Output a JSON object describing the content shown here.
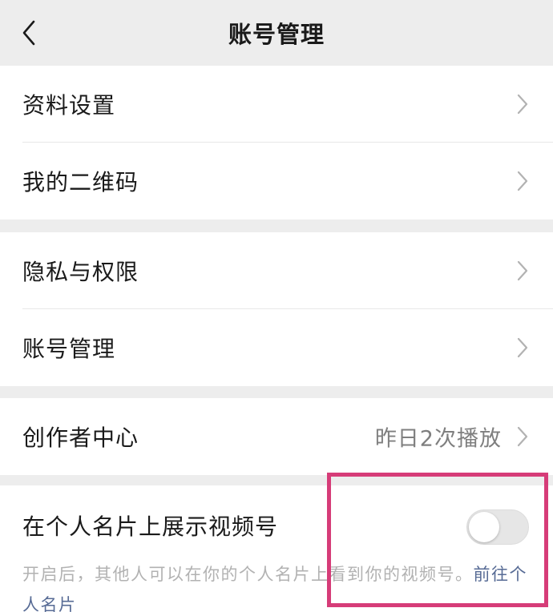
{
  "header": {
    "title": "账号管理",
    "back_icon": "chevron-left-icon"
  },
  "group1": {
    "items": [
      {
        "label": "资料设置"
      },
      {
        "label": "我的二维码"
      }
    ]
  },
  "group2": {
    "items": [
      {
        "label": "隐私与权限"
      },
      {
        "label": "账号管理"
      }
    ]
  },
  "group3": {
    "items": [
      {
        "label": "创作者中心",
        "value": "昨日2次播放"
      }
    ]
  },
  "group4": {
    "toggle_label": "在个人名片上展示视频号",
    "toggle_on": false,
    "description": "开启后，其他人可以在你的个人名片上看到你的视频号。",
    "link_text": "前往个人名片"
  },
  "colors": {
    "background": "#ededed",
    "link": "#576b95",
    "highlight": "#d63c78"
  }
}
